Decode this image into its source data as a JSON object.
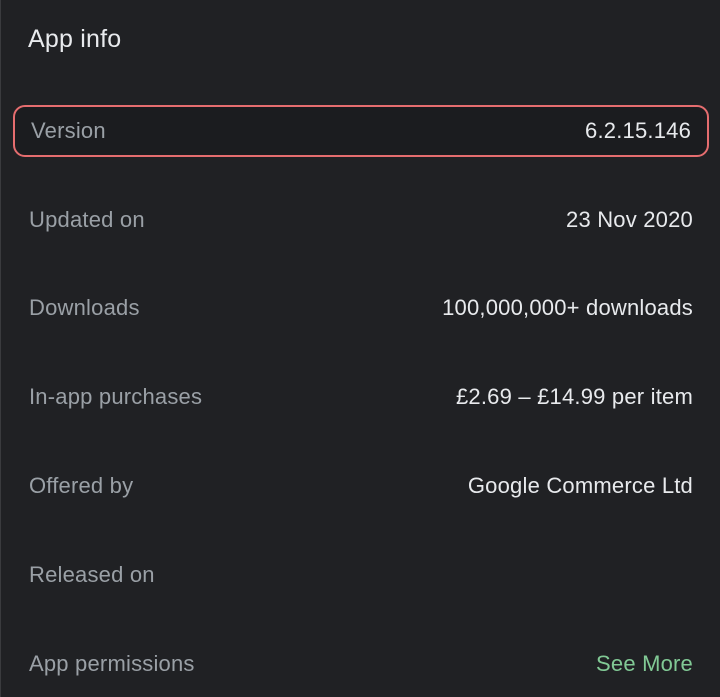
{
  "section": {
    "title": "App info"
  },
  "rows": [
    {
      "label": "Version",
      "value": "6.2.15.146"
    },
    {
      "label": "Updated on",
      "value": "23 Nov 2020"
    },
    {
      "label": "Downloads",
      "value": "100,000,000+ downloads"
    },
    {
      "label": "In-app purchases",
      "value": "£2.69 – £14.99 per item"
    },
    {
      "label": "Offered by",
      "value": "Google Commerce Ltd"
    },
    {
      "label": "Released on",
      "value": ""
    },
    {
      "label": "App permissions",
      "link": "See More"
    }
  ],
  "colors": {
    "background": "#202124",
    "label_text": "#9aa0a6",
    "value_text": "#e8eaed",
    "link_text": "#81c995",
    "highlight_border": "#e56d6f"
  }
}
